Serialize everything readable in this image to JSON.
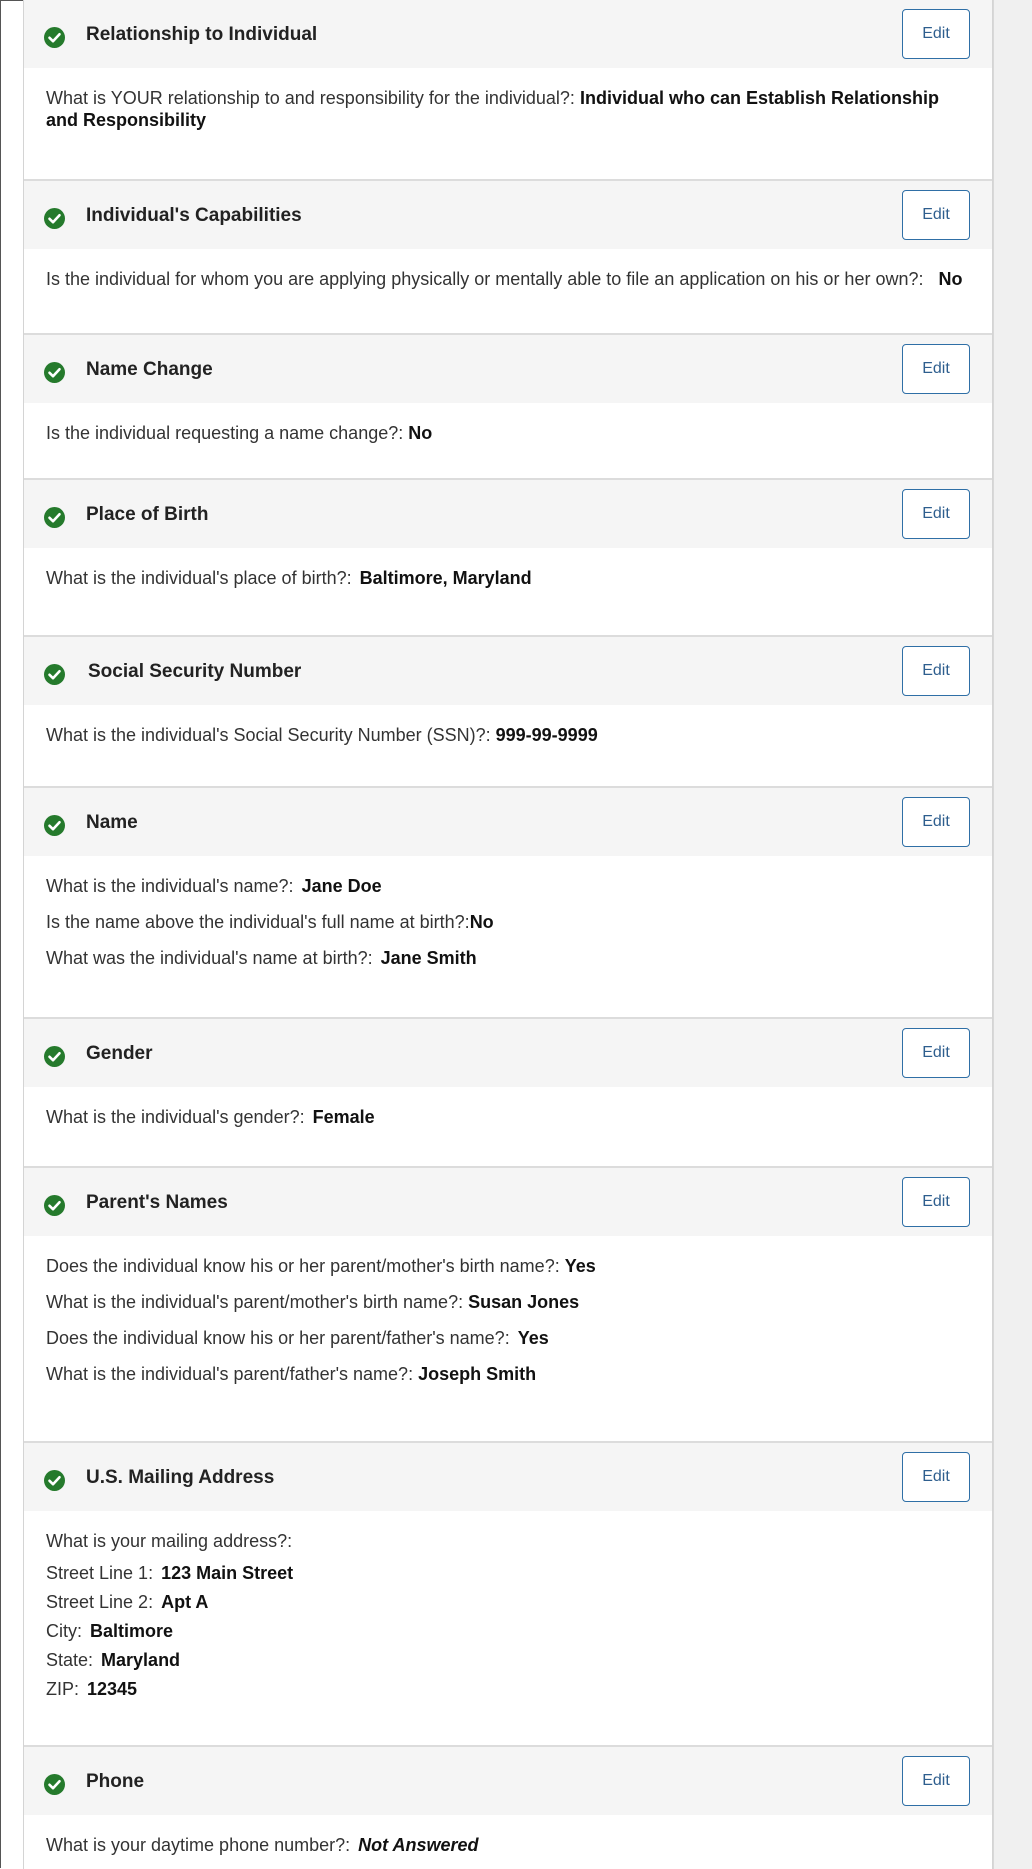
{
  "edit_label": "Edit",
  "colors": {
    "check": "#257a2c",
    "edit_border": "#2f6fa6",
    "header_bg": "#f5f5f5"
  },
  "sections": [
    {
      "title": "Relationship to Individual",
      "question": "What is YOUR relationship to and responsibility for the individual?:",
      "answer": "Individual who can Establish Relationship and Responsibility"
    },
    {
      "title": "Individual's Capabilities",
      "question": "Is the individual for whom you are applying physically or mentally able to file an application on his or her own?:",
      "answer": "No"
    },
    {
      "title": "Name Change",
      "question": "Is the individual requesting a name change?:",
      "answer": "No"
    },
    {
      "title": "Place of Birth",
      "question": "What is the individual's place of birth?:",
      "answer": "Baltimore, Maryland"
    },
    {
      "title": "Social Security Number",
      "question": "What is the individual's Social Security Number (SSN)?:",
      "answer": "999-99-9999"
    },
    {
      "title": "Name",
      "items": [
        {
          "question": "What is the individual's name?:",
          "answer": "Jane Doe"
        },
        {
          "question": "Is the name above the individual's full name at birth?:",
          "answer": "No"
        },
        {
          "question": "What was the individual's name at birth?:",
          "answer": "Jane Smith"
        }
      ]
    },
    {
      "title": "Gender",
      "question": "What is the individual's gender?:",
      "answer": "Female"
    },
    {
      "title": "Parent's Names",
      "items": [
        {
          "question": "Does the individual know his or her parent/mother's birth name?:",
          "answer": "Yes"
        },
        {
          "question": "What is the individual's parent/mother's birth name?:",
          "answer": "Susan Jones"
        },
        {
          "question": "Does the individual know his or her parent/father's name?:",
          "answer": "Yes"
        },
        {
          "question": "What is the individual's parent/father's name?:",
          "answer": "Joseph Smith"
        }
      ]
    },
    {
      "title": "U.S. Mailing Address",
      "question": "What is your mailing address?:",
      "address": [
        {
          "label": "Street Line 1:",
          "value": "123 Main Street"
        },
        {
          "label": "Street Line 2:",
          "value": "Apt A"
        },
        {
          "label": "City:",
          "value": "Baltimore"
        },
        {
          "label": "State:",
          "value": "Maryland"
        },
        {
          "label": "ZIP:",
          "value": "12345"
        }
      ]
    },
    {
      "title": "Phone",
      "question": "What is your daytime phone number?:",
      "answer": "Not Answered"
    }
  ]
}
